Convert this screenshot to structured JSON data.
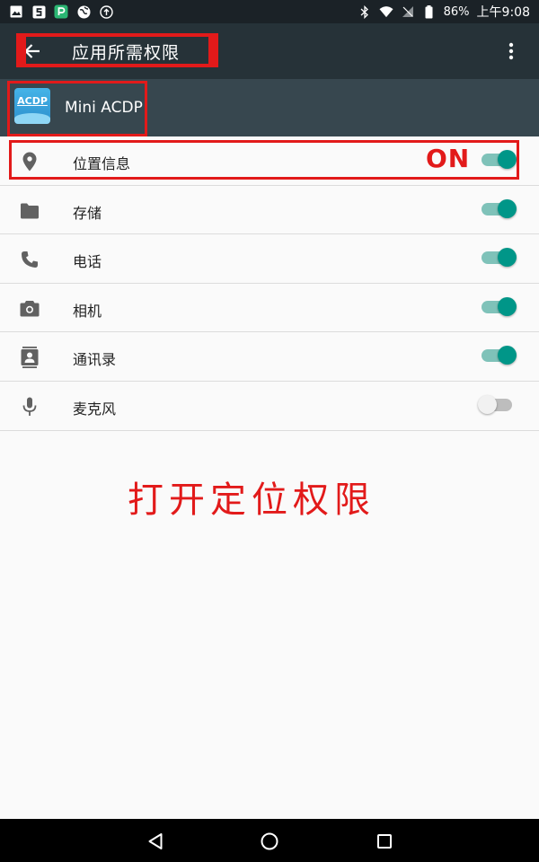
{
  "status_bar": {
    "battery": "86%",
    "time": "上午9:08"
  },
  "app_bar": {
    "title": "应用所需权限"
  },
  "app": {
    "name": "Mini ACDP",
    "icon_text": "ACDP"
  },
  "permissions": [
    {
      "label": "位置信息",
      "icon": "location-icon",
      "enabled": true
    },
    {
      "label": "存储",
      "icon": "folder-icon",
      "enabled": true
    },
    {
      "label": "电话",
      "icon": "phone-icon",
      "enabled": true
    },
    {
      "label": "相机",
      "icon": "camera-icon",
      "enabled": true
    },
    {
      "label": "通讯录",
      "icon": "contacts-icon",
      "enabled": true
    },
    {
      "label": "麦克风",
      "icon": "microphone-icon",
      "enabled": false
    }
  ],
  "annotations": {
    "on_label": "ON",
    "instruction": "打开定位权限"
  },
  "colors": {
    "accent": "#009688",
    "highlight": "#e21a1a",
    "app_bar": "#263238"
  }
}
